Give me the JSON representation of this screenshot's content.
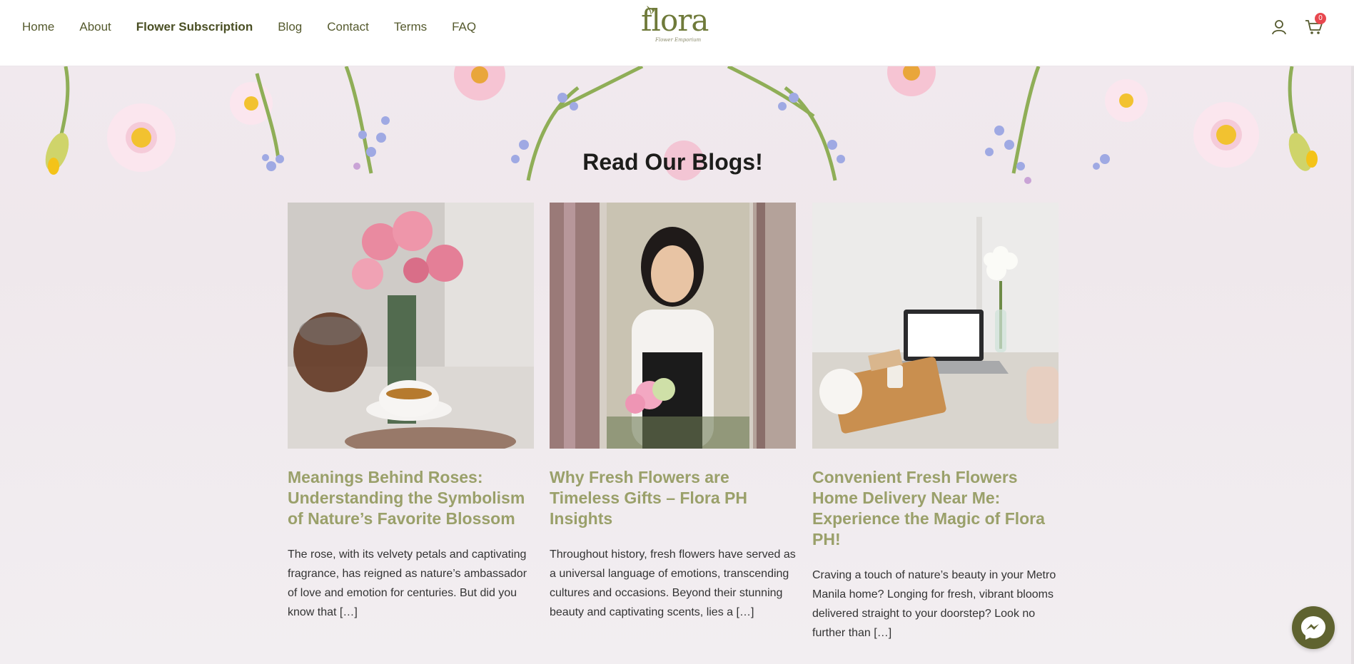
{
  "nav": {
    "items": [
      {
        "label": "Home",
        "active": false
      },
      {
        "label": "About",
        "active": false
      },
      {
        "label": "Flower Subscription",
        "active": true
      },
      {
        "label": "Blog",
        "active": false
      },
      {
        "label": "Contact",
        "active": false
      },
      {
        "label": "Terms",
        "active": false
      },
      {
        "label": "FAQ",
        "active": false
      }
    ]
  },
  "logo": {
    "text": "flora",
    "subtitle": "Flower Emporium"
  },
  "header_icons": {
    "account_icon": "user-icon",
    "cart_icon": "cart-icon",
    "cart_count": "0"
  },
  "blog_section": {
    "title": "Read Our Blogs!",
    "posts": [
      {
        "title": "Meanings Behind Roses: Understanding the Symbolism of Nature’s Favorite Blossom",
        "excerpt": "The rose, with its velvety petals and captivating fragrance, has reigned as nature’s ambassador of love and emotion for centuries. But did you know that […]",
        "image": "teapot-and-roses-photo"
      },
      {
        "title": "Why Fresh Flowers are Timeless Gifts – Flora PH Insights",
        "excerpt": "Throughout history, fresh flowers have served as a universal language of emotions, transcending cultures and occasions. Beyond their stunning beauty and captivating scents, lies a […]",
        "image": "florist-woman-photo"
      },
      {
        "title": "Convenient Fresh Flowers Home Delivery Near Me: Experience the Magic of Flora PH!",
        "excerpt": "Craving a touch of nature’s beauty in your Metro Manila home? Longing for fresh, vibrant blooms delivered straight to your doorstep? Look no further than […]",
        "image": "laptop-and-flowers-photo"
      }
    ]
  },
  "colors": {
    "accent": "#9aa06a",
    "nav_text": "#555a2e",
    "badge": "#e8484f",
    "messenger_bg": "#5f6330"
  },
  "chat_widget_icon": "messenger-icon"
}
